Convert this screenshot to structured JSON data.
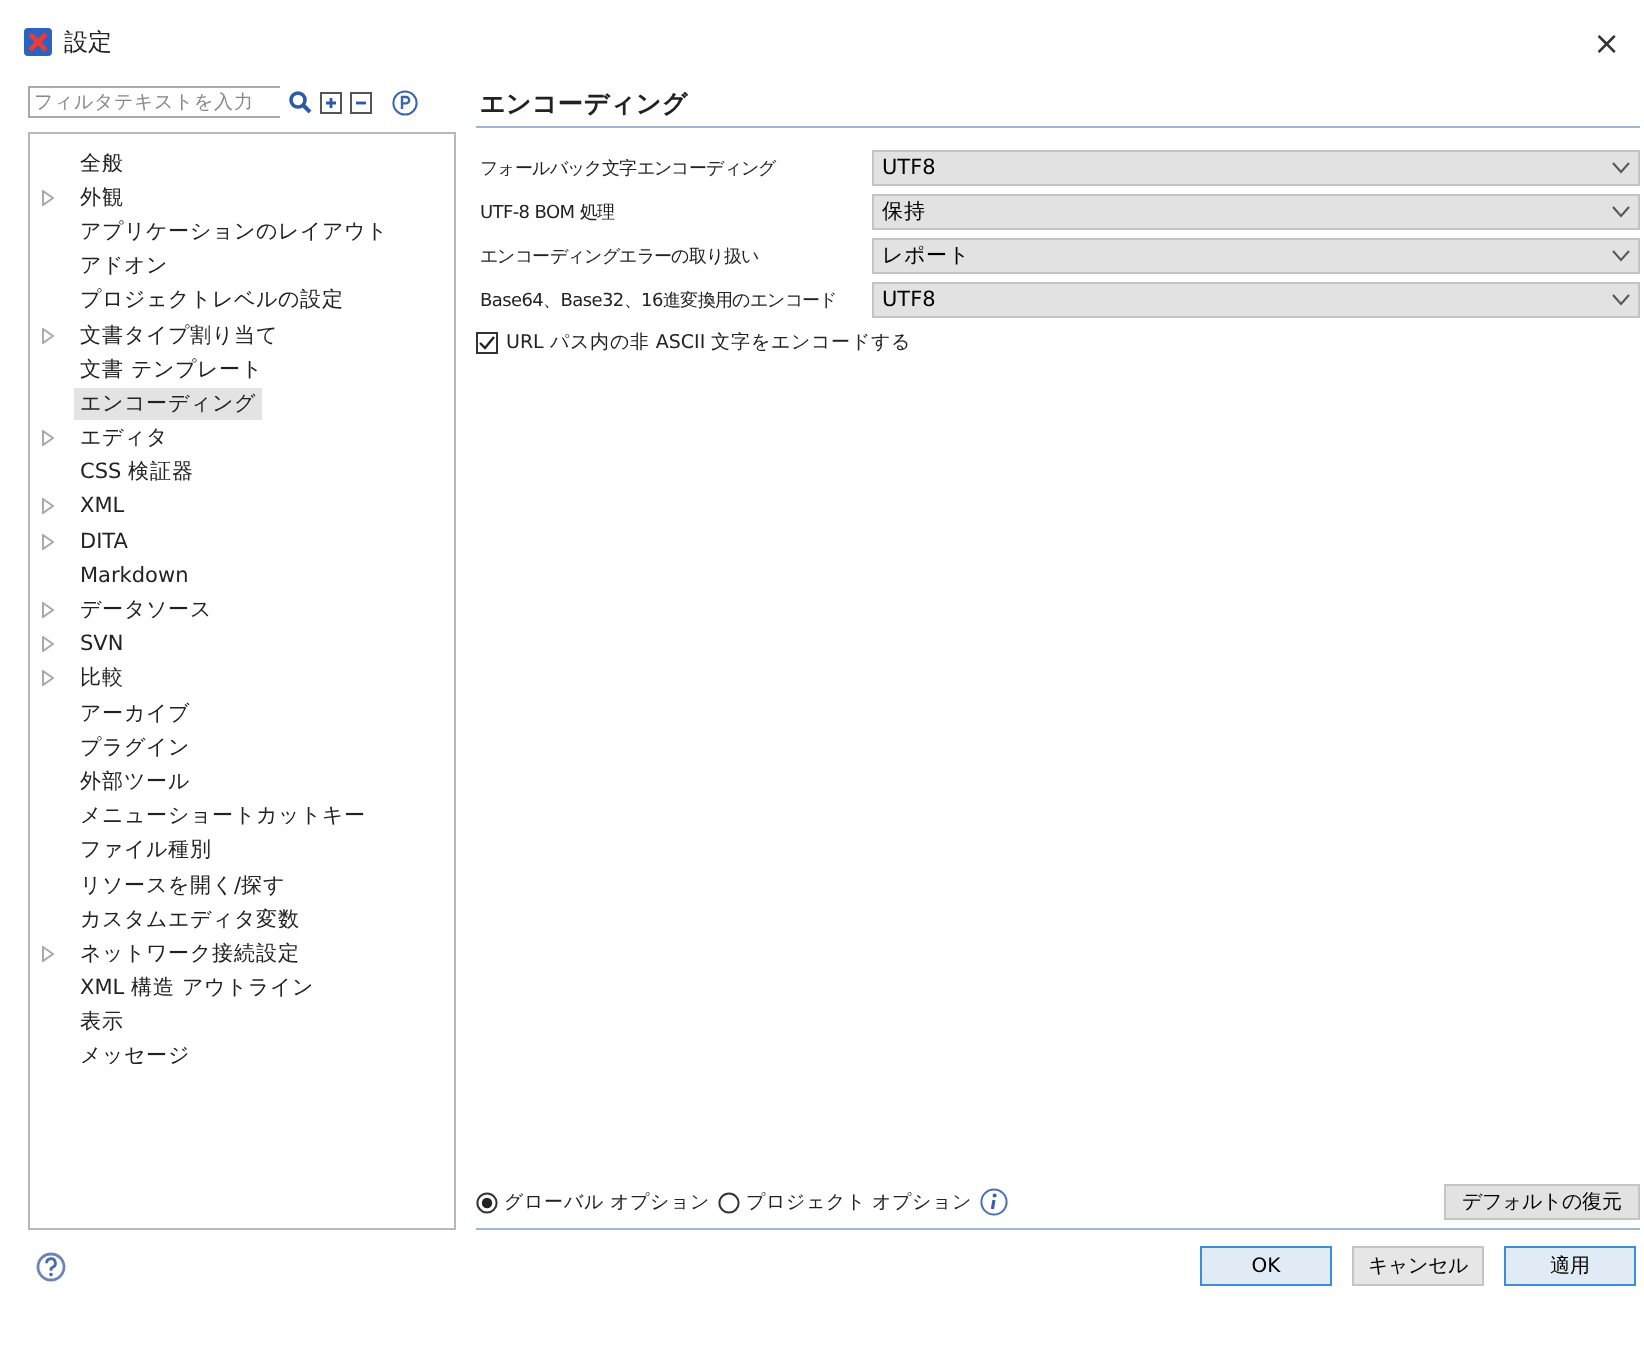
{
  "window": {
    "title": "設定",
    "close": "×"
  },
  "filter": {
    "placeholder": "フィルタテキストを入力"
  },
  "tree": [
    {
      "label": "全般",
      "selected": false
    },
    {
      "label": "外観",
      "selected": false,
      "expanded": false
    },
    {
      "label": "アプリケーションのレイアウト",
      "selected": false
    },
    {
      "label": "アドオン",
      "selected": false
    },
    {
      "label": "プロジェクトレベルの設定",
      "selected": false
    },
    {
      "label": "文書タイプ割り当て",
      "selected": false,
      "expanded": false
    },
    {
      "label": "文書 テンプレート",
      "selected": false
    },
    {
      "label": "エンコーディング",
      "selected": true
    },
    {
      "label": "エディタ",
      "selected": false,
      "expanded": false
    },
    {
      "label": "CSS 検証器",
      "selected": false
    },
    {
      "label": "XML",
      "selected": false,
      "expanded": false
    },
    {
      "label": "DITA",
      "selected": false,
      "expanded": false
    },
    {
      "label": "Markdown",
      "selected": false
    },
    {
      "label": "データソース",
      "selected": false,
      "expanded": false
    },
    {
      "label": "SVN",
      "selected": false,
      "expanded": false
    },
    {
      "label": "比較",
      "selected": false,
      "expanded": false
    },
    {
      "label": "アーカイブ",
      "selected": false
    },
    {
      "label": "プラグイン",
      "selected": false
    },
    {
      "label": "外部ツール",
      "selected": false
    },
    {
      "label": "メニューショートカットキー",
      "selected": false
    },
    {
      "label": "ファイル種別",
      "selected": false
    },
    {
      "label": "リソースを開く/探す",
      "selected": false
    },
    {
      "label": "カスタムエディタ変数",
      "selected": false
    },
    {
      "label": "ネットワーク接続設定",
      "selected": false,
      "expanded": false
    },
    {
      "label": "XML 構造 アウトライン",
      "selected": false
    },
    {
      "label": "表示",
      "selected": false
    },
    {
      "label": "メッセージ",
      "selected": false
    }
  ],
  "panel": {
    "title": "エンコーディング",
    "settings": [
      {
        "label": "フォールバック文字エンコーディング",
        "value": "UTF8"
      },
      {
        "label": "UTF-8 BOM 処理",
        "value": "保持"
      },
      {
        "label": "エンコーディングエラーの取り扱い",
        "value": "レポート"
      },
      {
        "label": "Base64、Base32、16進変換用のエンコード",
        "value": "UTF8"
      }
    ],
    "checkbox": {
      "label": "URL パス内の非 ASCII 文字をエンコードする",
      "checked": true
    }
  },
  "scope": [
    {
      "label": "グローバル オプション",
      "selected": true
    },
    {
      "label": "プロジェクト オプション",
      "selected": false
    }
  ],
  "restore_button": "デフォルトの復元",
  "buttons": [
    {
      "label": "OK",
      "kind": "default"
    },
    {
      "label": "キャンセル",
      "kind": "normal"
    },
    {
      "label": "適用",
      "kind": "default"
    }
  ]
}
